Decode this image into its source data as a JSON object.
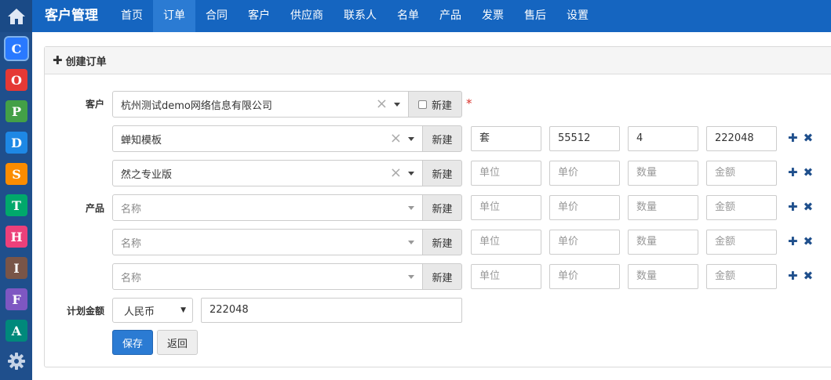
{
  "header": {
    "brand": "客户管理",
    "nav": [
      "首页",
      "订单",
      "合同",
      "客户",
      "供应商",
      "联系人",
      "名单",
      "产品",
      "发票",
      "售后",
      "设置"
    ],
    "active_nav": "订单"
  },
  "sidebar": {
    "apps": [
      {
        "glyph": "C",
        "color": "#2979ff",
        "selected": true
      },
      {
        "glyph": "O",
        "color": "#e53935"
      },
      {
        "glyph": "P",
        "color": "#43a047"
      },
      {
        "glyph": "D",
        "color": "#1e88e5"
      },
      {
        "glyph": "S",
        "color": "#fb8c00"
      },
      {
        "glyph": "T",
        "color": "#00a86b"
      },
      {
        "glyph": "H",
        "color": "#ec407a"
      },
      {
        "glyph": "I",
        "color": "#795548"
      },
      {
        "glyph": "F",
        "color": "#7e57c2"
      },
      {
        "glyph": "A",
        "color": "#00897b"
      }
    ],
    "settings_icon": "gear-icon"
  },
  "panel": {
    "title": "创建订单",
    "customer_label": "客户",
    "customer_value": "杭州测试demo网络信息有限公司",
    "new_label": "新建",
    "required_mark": "*",
    "product_label": "产品",
    "products": [
      {
        "name": "蝉知模板",
        "unit": "套",
        "price": "55512",
        "qty": "4",
        "amount": "222048",
        "filled": true
      },
      {
        "name": "然之专业版",
        "unit": "",
        "price": "",
        "qty": "",
        "amount": "",
        "filled": true
      },
      {
        "name": "",
        "unit": "",
        "price": "",
        "qty": "",
        "amount": "",
        "filled": false
      },
      {
        "name": "",
        "unit": "",
        "price": "",
        "qty": "",
        "amount": "",
        "filled": false
      },
      {
        "name": "",
        "unit": "",
        "price": "",
        "qty": "",
        "amount": "",
        "filled": false
      }
    ],
    "placeholders": {
      "name": "名称",
      "unit": "单位",
      "price": "单价",
      "qty": "数量",
      "amount": "金额"
    },
    "plan_amount_label": "计划金额",
    "currency": "人民币",
    "plan_amount": "222048",
    "save_label": "保存",
    "back_label": "返回"
  }
}
